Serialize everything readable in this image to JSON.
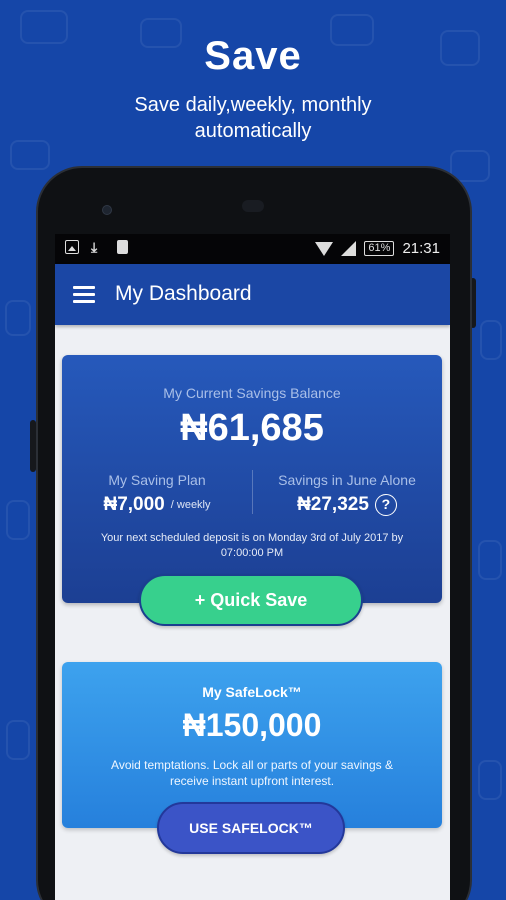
{
  "promo": {
    "title": "Save",
    "subtitle_line1": "Save daily,weekly, monthly",
    "subtitle_line2": "automatically"
  },
  "status_bar": {
    "battery": "61%",
    "time": "21:31",
    "left_icons": [
      "image-icon",
      "download-icon",
      "sim-card-icon"
    ],
    "right_icons": [
      "wifi-icon",
      "signal-icon",
      "battery-icon"
    ]
  },
  "app_bar": {
    "title": "My Dashboard",
    "menu_icon": "hamburger-menu-icon"
  },
  "balance_card": {
    "label": "My Current Savings Balance",
    "amount": "₦61,685",
    "plan_label": "My Saving Plan",
    "plan_amount": "₦7,000",
    "plan_period": "/ weekly",
    "month_label": "Savings in June Alone",
    "month_amount": "₦27,325",
    "help_icon": "?",
    "note": "Your next scheduled deposit is on Monday 3rd of July 2017 by 07:00:00 PM"
  },
  "quick_save": {
    "label": "+ Quick Save"
  },
  "safelock_card": {
    "title": "My SafeLock™",
    "amount": "₦150,000",
    "note": "Avoid temptations. Lock all or parts of your savings & receive instant upfront interest."
  },
  "use_safelock": {
    "label": "USE SAFELOCK™"
  },
  "colors": {
    "background": "#1546a8",
    "app_bar": "#1b47a5",
    "quick_save": "#37d08d",
    "safelock_card": "#2f8fe6",
    "use_safelock_button": "#3b54c7"
  }
}
